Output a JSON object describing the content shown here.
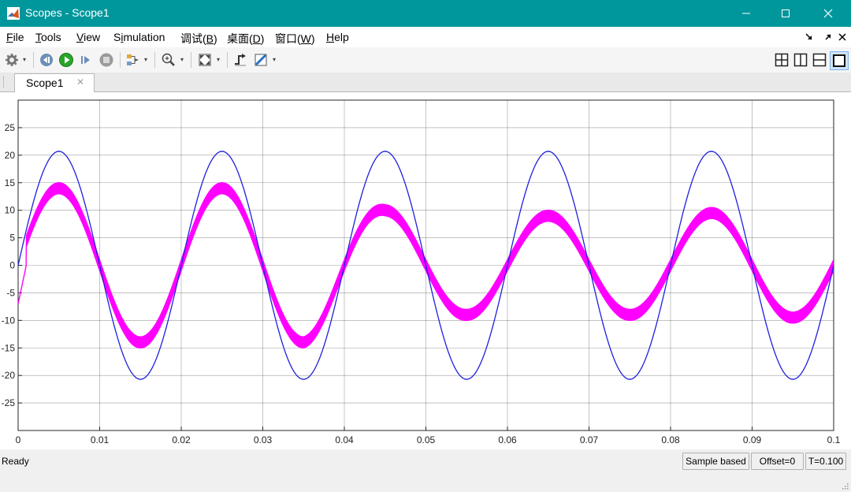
{
  "window": {
    "title": "Scopes - Scope1"
  },
  "menu": {
    "file": {
      "accel": "F",
      "rest": "ile"
    },
    "tools": {
      "accel": "T",
      "rest": "ools"
    },
    "view": {
      "accel": "V",
      "rest": "iew"
    },
    "simulation": {
      "pre": "S",
      "accel": "i",
      "rest": "mulation"
    },
    "debug": {
      "pre": "调试(",
      "accel": "B",
      "post": ")"
    },
    "desktop": {
      "pre": "桌面(",
      "accel": "D",
      "post": ")"
    },
    "window": {
      "pre": "窗口(",
      "accel": "W",
      "post": ")"
    },
    "help": {
      "accel": "H",
      "rest": "elp"
    }
  },
  "tab": {
    "label": "Scope1"
  },
  "status": {
    "ready": "Ready",
    "mode": "Sample based",
    "offset": "Offset=0",
    "time": "T=0.100"
  },
  "colors": {
    "titlebar": "#00979c",
    "series1": "#1f1fe0",
    "series2": "#ff00ff",
    "grid": "#262626"
  },
  "chart_data": {
    "type": "line",
    "xlim": [
      0,
      0.1
    ],
    "ylim": [
      -30,
      30
    ],
    "xticks": [
      "0",
      "0.01",
      "0.02",
      "0.03",
      "0.04",
      "0.05",
      "0.06",
      "0.07",
      "0.08",
      "0.09",
      "0.1"
    ],
    "yticks": [
      "25",
      "20",
      "15",
      "10",
      "5",
      "0",
      "-5",
      "-10",
      "-15",
      "-20",
      "-25"
    ],
    "ytick_values": [
      25,
      20,
      15,
      10,
      5,
      0,
      -5,
      -10,
      -15,
      -20,
      -25
    ],
    "xtick_values": [
      0,
      0.01,
      0.02,
      0.03,
      0.04,
      0.05,
      0.06,
      0.07,
      0.08,
      0.09,
      0.1
    ],
    "grid": true,
    "series": [
      {
        "color": "#1f1fe0",
        "frequency_hz": 50,
        "amplitude": 20.7,
        "x": [
          0,
          0.005,
          0.015,
          0.025,
          0.035,
          0.045,
          0.055,
          0.065,
          0.075,
          0.085,
          0.095,
          0.1
        ],
        "y": [
          0,
          20.7,
          -20.7,
          20.7,
          -20.7,
          20.7,
          -20.7,
          20.7,
          -20.7,
          20.7,
          -20.7,
          0
        ]
      },
      {
        "color": "#ff00ff",
        "frequency_hz": 50,
        "x": [
          0,
          0.005,
          0.015,
          0.025,
          0.035,
          0.045,
          0.055,
          0.065,
          0.075,
          0.085,
          0.095,
          0.1
        ],
        "y": [
          -7,
          14,
          -14,
          14,
          -14,
          10,
          -9,
          9,
          -9,
          9.5,
          -9.5,
          0
        ]
      }
    ]
  }
}
